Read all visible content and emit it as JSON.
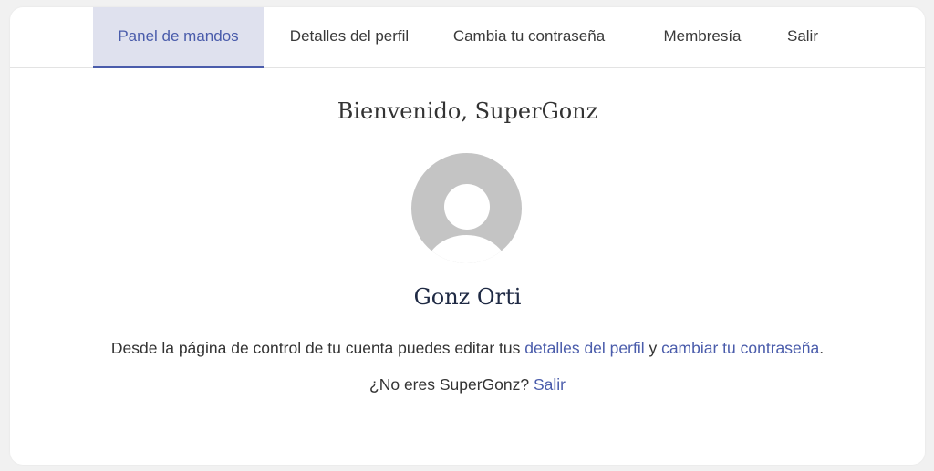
{
  "tabs": [
    {
      "label": "Panel de mandos",
      "active": true
    },
    {
      "label": "Detalles del perfil",
      "active": false
    },
    {
      "label": "Cambia tu contraseña",
      "active": false
    },
    {
      "label": "Membresía",
      "active": false
    },
    {
      "label": "Salir",
      "active": false
    }
  ],
  "welcome": "Bienvenido, SuperGonz",
  "avatar_icon": "default-user-avatar-icon",
  "full_name": "Gonz Orti",
  "description": {
    "before": "Desde la página de control de tu cuenta puedes editar tus ",
    "profile_link": "detalles del perfil",
    "middle": " y ",
    "password_link": "cambiar tu contraseña",
    "after": "."
  },
  "not_you": {
    "text": "¿No eres SuperGonz? ",
    "logout_link": "Salir"
  },
  "colors": {
    "accent": "#4a5cab",
    "active_tab_bg": "#dfe1ee",
    "avatar_gray": "#c4c4c4",
    "page_bg": "#f1f1f1"
  }
}
